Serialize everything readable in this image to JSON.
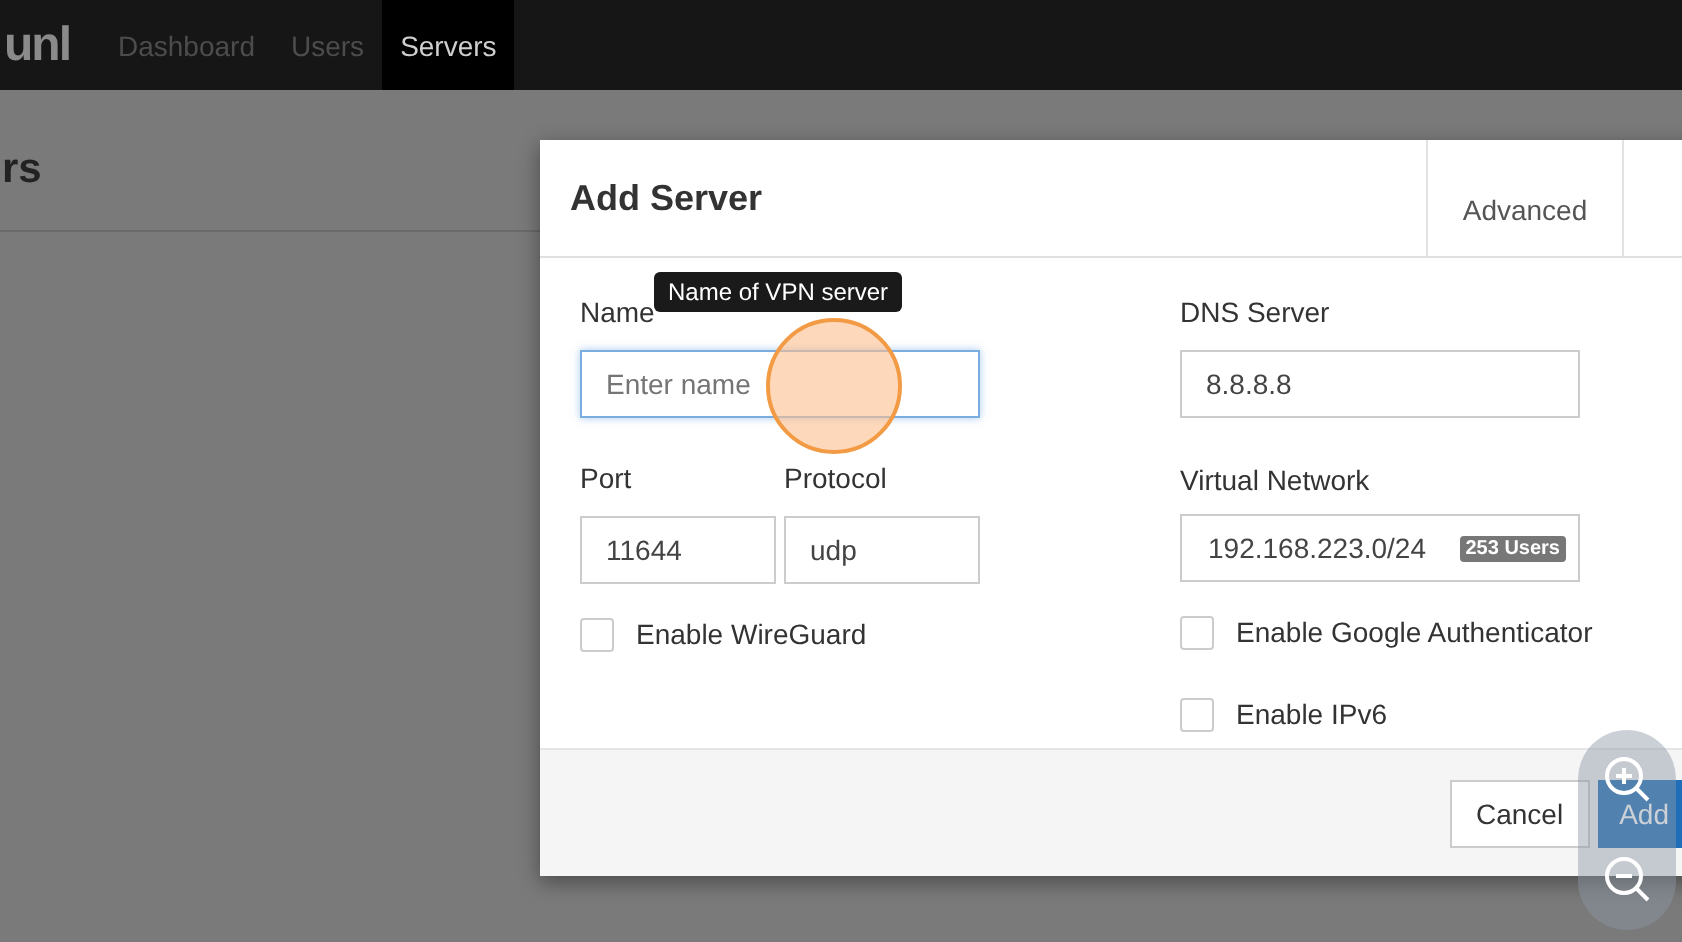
{
  "navbar": {
    "logo": "unl",
    "items": [
      {
        "label": "Dashboard",
        "selected": false
      },
      {
        "label": "Users",
        "selected": false
      },
      {
        "label": "Servers",
        "selected": true
      }
    ]
  },
  "page": {
    "title": "rs"
  },
  "dialog": {
    "title": "Add Server",
    "tabs": [
      {
        "label": "Advanced",
        "selected": false
      }
    ],
    "name": {
      "label": "Name",
      "placeholder": "Enter name",
      "tooltip": "Name of VPN server",
      "focused": true
    },
    "port": {
      "label": "Port",
      "value": "11644"
    },
    "protocol": {
      "label": "Protocol",
      "value": "udp"
    },
    "dns": {
      "label": "DNS Server",
      "value": "8.8.8.8"
    },
    "network": {
      "label": "Virtual Network",
      "value": "192.168.223.0/24",
      "badge": "253 Users"
    },
    "left_checks": [
      {
        "label": "Enable WireGuard",
        "checked": false
      }
    ],
    "right_checks": [
      {
        "label": "Enable Google Authenticator",
        "checked": false
      },
      {
        "label": "Enable IPv6",
        "checked": false
      }
    ],
    "buttons": [
      {
        "label": "Cancel",
        "kind": "default"
      },
      {
        "label": "Add",
        "kind": "primary"
      }
    ]
  }
}
